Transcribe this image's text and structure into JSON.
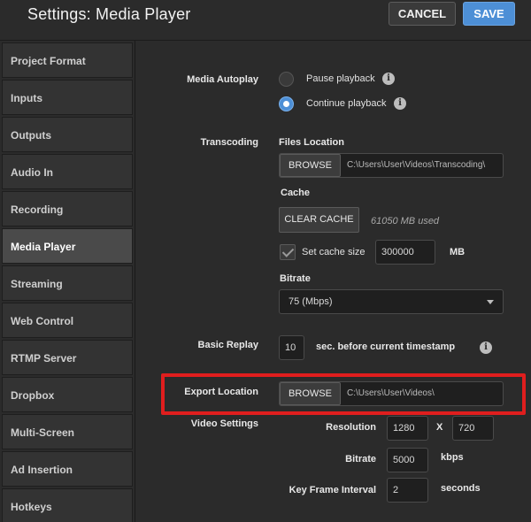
{
  "header": {
    "title": "Settings: Media Player",
    "cancel_label": "CANCEL",
    "save_label": "SAVE"
  },
  "sidebar": {
    "items": [
      {
        "label": "Project Format"
      },
      {
        "label": "Inputs"
      },
      {
        "label": "Outputs"
      },
      {
        "label": "Audio In"
      },
      {
        "label": "Recording"
      },
      {
        "label": "Media Player",
        "active": true
      },
      {
        "label": "Streaming"
      },
      {
        "label": "Web Control"
      },
      {
        "label": "RTMP Server"
      },
      {
        "label": "Dropbox"
      },
      {
        "label": "Multi-Screen"
      },
      {
        "label": "Ad Insertion"
      },
      {
        "label": "Hotkeys"
      }
    ]
  },
  "media_autoplay": {
    "label": "Media Autoplay",
    "options": [
      {
        "label": "Pause playback",
        "selected": false
      },
      {
        "label": "Continue playback",
        "selected": true
      }
    ]
  },
  "transcoding": {
    "label": "Transcoding",
    "files_location_label": "Files Location",
    "browse_label": "BROWSE",
    "path": "C:\\Users\\User\\Videos\\Transcoding\\",
    "cache_label": "Cache",
    "clear_cache_label": "CLEAR CACHE",
    "cache_used": "61050 MB used",
    "set_cache_size_label": "Set cache size",
    "cache_size_value": "300000",
    "cache_unit": "MB",
    "bitrate_label": "Bitrate",
    "bitrate_value": "75 (Mbps)"
  },
  "basic_replay": {
    "label": "Basic Replay",
    "value": "10",
    "suffix": "sec. before current timestamp"
  },
  "export_location": {
    "label": "Export Location",
    "browse_label": "BROWSE",
    "path": "C:\\Users\\User\\Videos\\"
  },
  "video_settings": {
    "label": "Video Settings",
    "resolution_label": "Resolution",
    "width": "1280",
    "x_label": "X",
    "height": "720",
    "bitrate_label": "Bitrate",
    "bitrate_value": "5000",
    "bitrate_unit": "kbps",
    "keyframe_label": "Key Frame Interval",
    "keyframe_value": "2",
    "keyframe_unit": "seconds"
  },
  "colors": {
    "accent": "#4d8fd6",
    "highlight": "#e01e1e"
  }
}
